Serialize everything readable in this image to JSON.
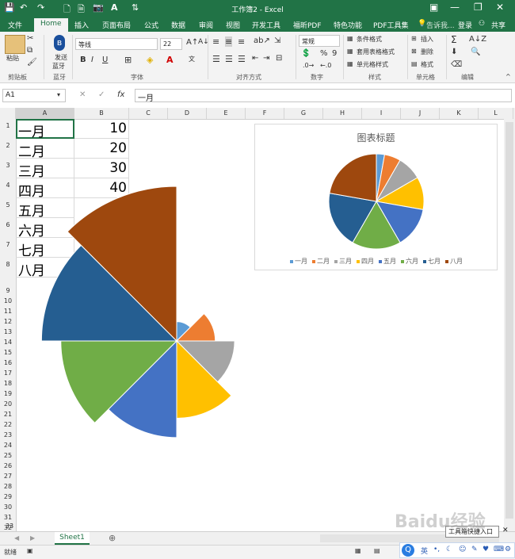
{
  "titlebar": {
    "title": "工作簿2 - Excel",
    "save_icon": "save-icon",
    "undo_icon": "undo-icon",
    "redo_icon": "redo-icon",
    "minimize": "—",
    "restore": "❐",
    "close": "✕"
  },
  "tabs": [
    {
      "label": "文件"
    },
    {
      "label": "Home"
    },
    {
      "label": "插入"
    },
    {
      "label": "页面布局"
    },
    {
      "label": "公式"
    },
    {
      "label": "数据"
    },
    {
      "label": "审阅"
    },
    {
      "label": "视图"
    },
    {
      "label": "开发工具"
    },
    {
      "label": "福昕PDF"
    },
    {
      "label": "特色功能"
    },
    {
      "label": "PDF工具集"
    }
  ],
  "tell_me": "告诉我...",
  "login": "登录",
  "share": "共享",
  "ribbon": {
    "paste": "粘贴",
    "send": "发送",
    "send2": "蓝牙",
    "font_name": "等线",
    "font_size": "22",
    "bold": "B",
    "italic": "I",
    "underline": "U",
    "number_format": "常规",
    "percent": "%",
    "comma": "9",
    "cond_format": "条件格式",
    "table_format": "套用表格格式",
    "cell_style": "单元格样式",
    "insert": "插入",
    "delete": "删除",
    "format": "格式",
    "groups": {
      "clipboard": "剪贴板",
      "send": "蓝牙",
      "font": "字体",
      "align": "对齐方式",
      "number": "数字",
      "style": "样式",
      "cells": "单元格",
      "edit": "编辑"
    }
  },
  "formula_bar": {
    "name_box": "A1",
    "fx": "fx",
    "content": "一月"
  },
  "columns": [
    "A",
    "B",
    "C",
    "D",
    "E",
    "F",
    "G",
    "H",
    "I",
    "J",
    "K",
    "L"
  ],
  "rows": [
    "1",
    "2",
    "3",
    "4",
    "5",
    "6",
    "7",
    "8",
    "9",
    "10",
    "11",
    "12",
    "13",
    "14",
    "15",
    "16",
    "17",
    "18",
    "19",
    "20",
    "21",
    "22",
    "23",
    "24",
    "25",
    "26",
    "27",
    "28",
    "29",
    "30",
    "31",
    "32",
    "33"
  ],
  "cells": [
    {
      "label": "一月",
      "value": "10"
    },
    {
      "label": "二月",
      "value": "20"
    },
    {
      "label": "三月",
      "value": "30"
    },
    {
      "label": "四月",
      "value": "40"
    },
    {
      "label": "五月",
      "value": ""
    },
    {
      "label": "六月",
      "value": ""
    },
    {
      "label": "七月",
      "value": ""
    },
    {
      "label": "八月",
      "value": ""
    }
  ],
  "chart_data": [
    {
      "type": "pie",
      "title": "图表标题",
      "categories": [
        "一月",
        "二月",
        "三月",
        "四月",
        "五月",
        "六月",
        "七月",
        "八月"
      ],
      "values": [
        10,
        20,
        30,
        40,
        50,
        60,
        70,
        80
      ],
      "colors": [
        "#5B9BD5",
        "#ED7D31",
        "#A5A5A5",
        "#FFC000",
        "#4472C4",
        "#70AD47",
        "#255E91",
        "#9E480E"
      ],
      "legend": "bottom"
    },
    {
      "type": "pie",
      "title": "",
      "style": "polar-area",
      "categories": [
        "一月",
        "二月",
        "三月",
        "四月",
        "五月",
        "六月",
        "七月",
        "八月"
      ],
      "values": [
        10,
        20,
        30,
        40,
        50,
        60,
        70,
        80
      ],
      "colors": [
        "#5B9BD5",
        "#ED7D31",
        "#A5A5A5",
        "#FFC000",
        "#4472C4",
        "#70AD47",
        "#255E91",
        "#9E480E"
      ]
    }
  ],
  "sheet_tab": "Sheet1",
  "status": "就绪",
  "watermark": "Baidu经验",
  "tooltip": "工具箱快捷入口",
  "ime": "英"
}
